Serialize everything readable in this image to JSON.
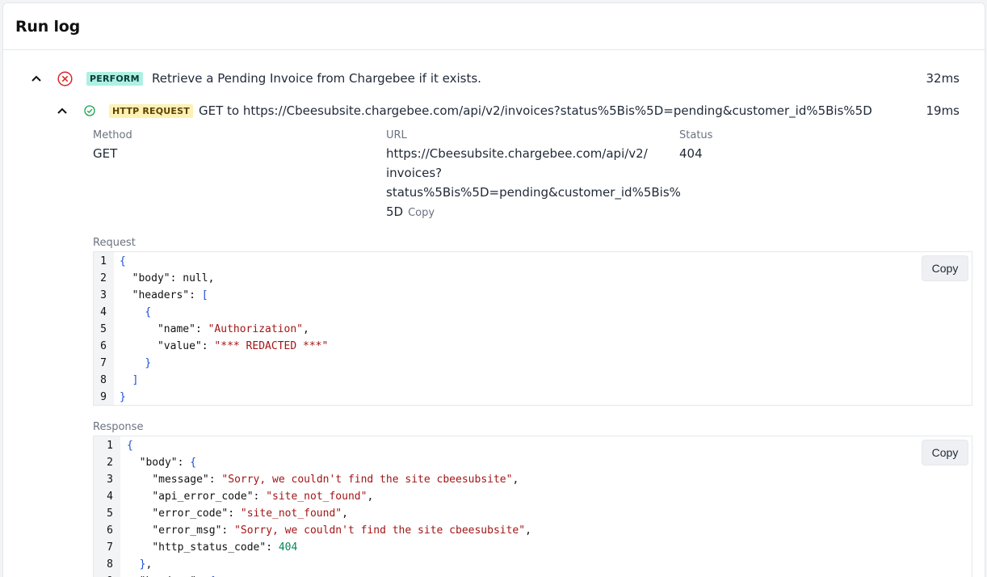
{
  "header": {
    "title": "Run log"
  },
  "perform_step": {
    "badge": "PERFORM",
    "text": "Retrieve a Pending Invoice from Chargebee if it exists.",
    "duration": "32ms",
    "status_color": "#dc2626"
  },
  "http_step": {
    "badge": "HTTP REQUEST",
    "text": "GET to https://Cbeesubsite.chargebee.com/api/v2/invoices?status%5Bis%5D=pending&customer_id%5Bis%5D",
    "duration": "19ms",
    "status_color": "#16a34a"
  },
  "details": {
    "method_label": "Method",
    "method_value": "GET",
    "url_label": "URL",
    "url_lines": [
      "https://Cbeesubsite.chargebee.com/api/v2/",
      "invoices?",
      "status%5Bis%5D=pending&customer_id%5Bis%",
      "5D"
    ],
    "url_copy": "Copy",
    "status_label": "Status",
    "status_value": "404"
  },
  "request": {
    "label": "Request",
    "copy_label": "Copy",
    "lines": [
      "{",
      "  \"body\": null,",
      "  \"headers\": [",
      "    {",
      "      \"name\": \"Authorization\",",
      "      \"value\": \"*** REDACTED ***\"",
      "    }",
      "  ]",
      "}"
    ]
  },
  "response": {
    "label": "Response",
    "copy_label": "Copy",
    "lines": [
      "{",
      "  \"body\": {",
      "    \"message\": \"Sorry, we couldn't find the site cbeesubsite\",",
      "    \"api_error_code\": \"site_not_found\",",
      "    \"error_code\": \"site_not_found\",",
      "    \"error_msg\": \"Sorry, we couldn't find the site cbeesubsite\",",
      "    \"http_status_code\": 404",
      "  },",
      "  \"headers\": {"
    ]
  },
  "icons": {
    "perform_chevron": "chevron-up-icon",
    "perform_status": "error-circle-icon",
    "http_chevron": "chevron-up-icon",
    "http_status": "success-circle-icon"
  }
}
